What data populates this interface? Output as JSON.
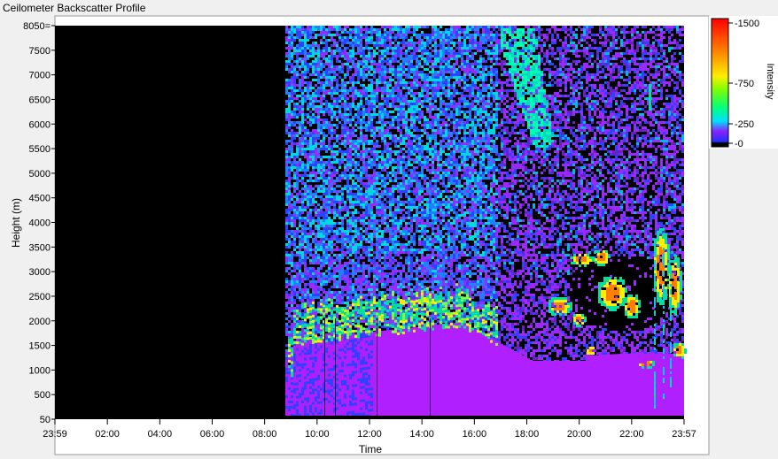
{
  "window": {
    "title": "Ceilometer Backscatter Profile"
  },
  "chart_data": {
    "type": "heatmap",
    "title": "",
    "xlabel": "Time",
    "ylabel": "Height (m)",
    "x_ticks": [
      "23:59",
      "02:00",
      "04:00",
      "06:00",
      "08:00",
      "10:00",
      "12:00",
      "14:00",
      "16:00",
      "18:00",
      "20:00",
      "22:00",
      "23:57"
    ],
    "y_ticks": [
      "50",
      "500",
      "1000",
      "1500",
      "2000",
      "2500",
      "3000",
      "3500",
      "4000",
      "4500",
      "5000",
      "5500",
      "6000",
      "6500",
      "7000",
      "7500",
      "8050="
    ],
    "ylim": [
      50,
      8050
    ],
    "colorbar": {
      "label": "Intensity",
      "ticks": [
        "1500",
        "750",
        "250",
        "0"
      ],
      "range": [
        0,
        1500
      ]
    },
    "no_data_until": "08:45",
    "colors": {
      "no_data": "#000000",
      "low": "#3040ff",
      "mid_low": "#9a28ff",
      "boundary_layer": "#b020ff",
      "cloud_edge": "#00e0a0",
      "cloud_core": "#ffee00",
      "peak": "#ff2000"
    }
  }
}
